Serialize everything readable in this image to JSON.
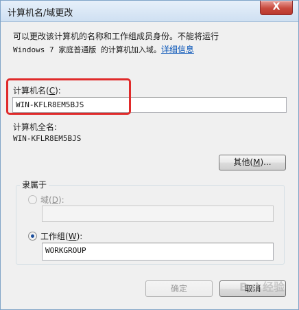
{
  "window": {
    "title": "计算机名/域更改",
    "close_glyph": "X"
  },
  "description": {
    "line1": "可以更改该计算机的名称和工作组成员身份。不能将运行",
    "line2": "Windows 7 家庭普通版 的计算机加入域。",
    "link": "详细信息"
  },
  "computer_name": {
    "label_prefix": "计算机名(",
    "label_key": "C",
    "label_suffix": "):",
    "value": "WIN-KFLR8EM5BJS"
  },
  "full_name": {
    "label": "计算机全名:",
    "value": "WIN-KFLR8EM5BJS"
  },
  "more_button": {
    "label_prefix": "其他(",
    "label_key": "M",
    "label_suffix": ")..."
  },
  "member_of": {
    "title": "隶属于",
    "domain": {
      "label_prefix": "域(",
      "label_key": "D",
      "label_suffix": "):",
      "value": ""
    },
    "workgroup": {
      "label_prefix": "工作组(",
      "label_key": "W",
      "label_suffix": "):",
      "value": "WORKGROUP"
    }
  },
  "footer": {
    "ok_label": "确定",
    "cancel_label": "取消",
    "watermark": "Bai 经验"
  },
  "colors": {
    "highlight": "#e02a2a",
    "link": "#0a56b8"
  }
}
